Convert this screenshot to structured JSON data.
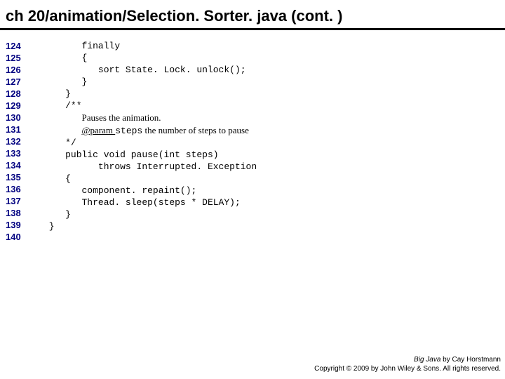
{
  "title": "ch 20/animation/Selection. Sorter. java (cont. )",
  "lineNumbers": [
    "124",
    "125",
    "126",
    "127",
    "128",
    "129",
    "130",
    "131",
    "132",
    "133",
    "134",
    "135",
    "136",
    "137",
    "138",
    "139",
    "140"
  ],
  "code": {
    "l124": "      finally",
    "l125": "      {",
    "l126": "         sort State. Lock. unlock();",
    "l127": "      }",
    "l128": "   }",
    "l129": "",
    "l130": "   /**",
    "l131_pre": "      ",
    "l131_doc": "Pauses the animation.",
    "l132_pre": "      ",
    "l132_at": "@param ",
    "l132_code": "steps",
    "l132_doc": " the number of steps to pause",
    "l133": "   */",
    "l134": "   public void pause(int steps)",
    "l135": "         throws Interrupted. Exception",
    "l136": "   {",
    "l137": "      component. repaint();",
    "l138": "      Thread. sleep(steps * DELAY);",
    "l139": "   }",
    "l140": "}"
  },
  "footer": {
    "book": "Big Java",
    "by": " by Cay Horstmann",
    "copyright": "Copyright © 2009 by John Wiley & Sons. All rights reserved."
  }
}
